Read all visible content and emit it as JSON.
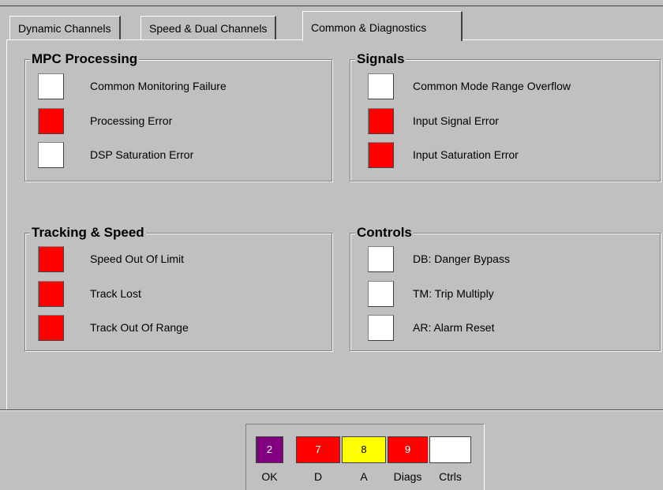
{
  "tabs": [
    {
      "label": "Dynamic Channels",
      "active": false
    },
    {
      "label": "Speed & Dual Channels",
      "active": false
    },
    {
      "label": "Common & Diagnostics",
      "active": true
    }
  ],
  "colors": {
    "alarm": "#ff0000",
    "normal": "#ffffff",
    "ok": "#800080",
    "alert": "#ffff00"
  },
  "groups": {
    "mpc_processing": {
      "title": "MPC Processing",
      "items": [
        {
          "label": "Common Monitoring Failure",
          "state": "normal"
        },
        {
          "label": "Processing Error",
          "state": "alarm"
        },
        {
          "label": "DSP Saturation Error",
          "state": "normal"
        }
      ]
    },
    "signals": {
      "title": "Signals",
      "items": [
        {
          "label": "Common Mode Range Overflow",
          "state": "normal"
        },
        {
          "label": "Input Signal Error",
          "state": "alarm"
        },
        {
          "label": "Input Saturation Error",
          "state": "alarm"
        }
      ]
    },
    "tracking_speed": {
      "title": "Tracking & Speed",
      "items": [
        {
          "label": "Speed Out Of Limit",
          "state": "alarm"
        },
        {
          "label": "Track Lost",
          "state": "alarm"
        },
        {
          "label": "Track Out Of Range",
          "state": "alarm"
        }
      ]
    },
    "controls": {
      "title": "Controls",
      "items": [
        {
          "label": "DB: Danger Bypass",
          "state": "normal"
        },
        {
          "label": "TM: Trip Multiply",
          "state": "normal"
        },
        {
          "label": "AR: Alarm Reset",
          "state": "normal"
        }
      ]
    }
  },
  "summary": [
    {
      "value": "2",
      "label": "OK",
      "color": "#800080",
      "text_color": "#ffffff"
    },
    {
      "value": "7",
      "label": "D",
      "color": "#ff0000",
      "text_color": "#ffffff"
    },
    {
      "value": "8",
      "label": "A",
      "color": "#ffff00",
      "text_color": "#000000"
    },
    {
      "value": "9",
      "label": "Diags",
      "color": "#ff0000",
      "text_color": "#ffffff"
    },
    {
      "value": "",
      "label": "Ctrls",
      "color": "#ffffff",
      "text_color": "#000000"
    }
  ]
}
